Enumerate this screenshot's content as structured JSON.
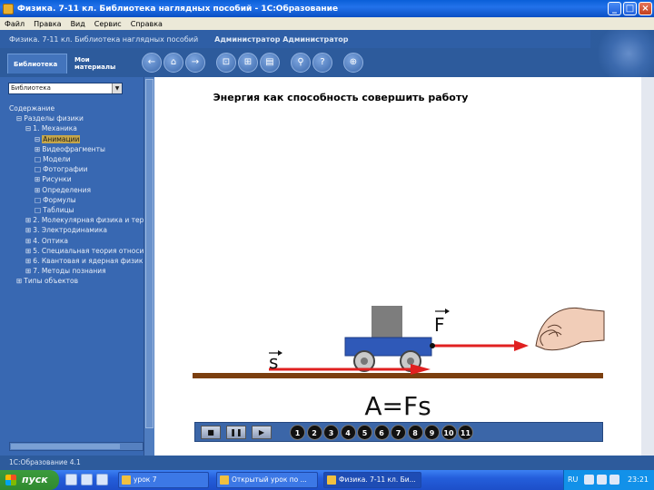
{
  "window": {
    "title": "Физика. 7-11 кл. Библиотека наглядных пособий - 1С:Образование",
    "buttons": [
      "_",
      "□",
      "×"
    ]
  },
  "menu": [
    "Файл",
    "Правка",
    "Вид",
    "Сервис",
    "Справка"
  ],
  "app_header": {
    "title": "Физика. 7-11 кл. Библиотека наглядных пособий",
    "user": "Администратор Администратор"
  },
  "toolbar": {
    "tab_library": "Библиотека",
    "tab_my_materials": "Мои материалы",
    "icons": [
      "back-icon",
      "home-icon",
      "forward-icon",
      "cart-icon",
      "cart-add-icon",
      "print-icon",
      "search-icon",
      "help-icon",
      "zoom-icon"
    ]
  },
  "sidebar": {
    "selector": "Библиотека",
    "tree": [
      {
        "label": "Содержание",
        "indent": 0,
        "marker": ""
      },
      {
        "label": "Разделы физики",
        "indent": 1,
        "marker": "⊟"
      },
      {
        "label": "1. Механика",
        "indent": 2,
        "marker": "⊟"
      },
      {
        "label": "Анимации",
        "indent": 3,
        "marker": "⊟",
        "highlight": true
      },
      {
        "label": "Видеофрагменты",
        "indent": 3,
        "marker": "⊞"
      },
      {
        "label": "Модели",
        "indent": 3,
        "marker": "□"
      },
      {
        "label": "Фотографии",
        "indent": 3,
        "marker": "□"
      },
      {
        "label": "Рисунки",
        "indent": 3,
        "marker": "⊞"
      },
      {
        "label": "Определения",
        "indent": 3,
        "marker": "⊞"
      },
      {
        "label": "Формулы",
        "indent": 3,
        "marker": "□"
      },
      {
        "label": "Таблицы",
        "indent": 3,
        "marker": "□"
      },
      {
        "label": "2. Молекулярная физика и тер",
        "indent": 2,
        "marker": "⊞"
      },
      {
        "label": "3. Электродинамика",
        "indent": 2,
        "marker": "⊞"
      },
      {
        "label": "4. Оптика",
        "indent": 2,
        "marker": "⊞"
      },
      {
        "label": "5. Специальная теория относи",
        "indent": 2,
        "marker": "⊞"
      },
      {
        "label": "6. Квантовая и ядерная физик",
        "indent": 2,
        "marker": "⊞"
      },
      {
        "label": "7. Методы познания",
        "indent": 2,
        "marker": "⊞"
      },
      {
        "label": "Типы объектов",
        "indent": 1,
        "marker": "⊞"
      }
    ]
  },
  "content": {
    "heading": "Энергия как способность совершить работу",
    "force_label": "F",
    "displacement_label": "s",
    "formula": "A=Fs",
    "player_numbers": [
      "1",
      "2",
      "3",
      "4",
      "5",
      "6",
      "7",
      "8",
      "9",
      "10",
      "11"
    ]
  },
  "status": "1С:Образование 4.1",
  "taskbar": {
    "start": "пуск",
    "tasks": [
      "урок 7",
      "Открытый урок по ...",
      "Физика. 7-11 кл. Би..."
    ],
    "lang": "RU",
    "clock": "23:21"
  }
}
